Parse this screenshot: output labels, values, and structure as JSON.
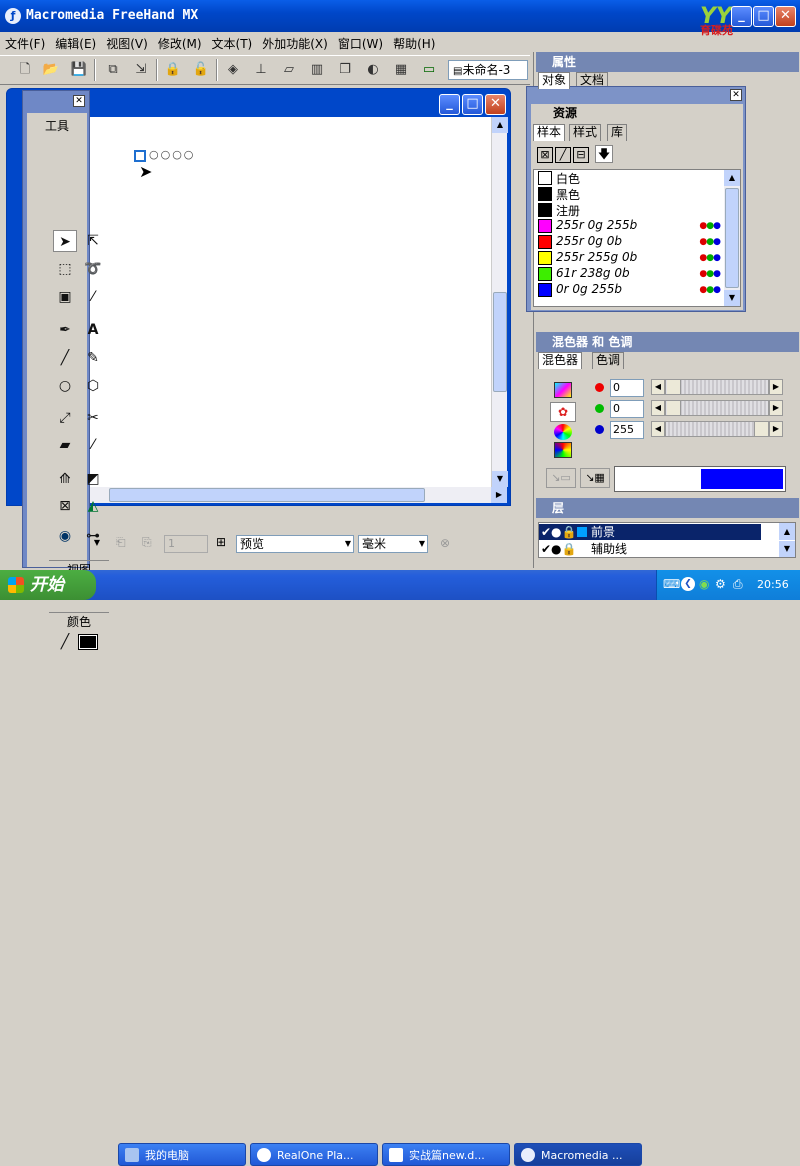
{
  "app": {
    "title": "Macromedia FreeHand MX",
    "logo_text": "育碟苑"
  },
  "menu": [
    "文件(F)",
    "编辑(E)",
    "视图(V)",
    "修改(M)",
    "文本(T)",
    "外加功能(X)",
    "窗口(W)",
    "帮助(H)"
  ],
  "toolbar": {
    "doc_select": "未命名-3"
  },
  "tools_panel": {
    "title": "工具",
    "view_label": "视图",
    "color_label": "颜色"
  },
  "status_bar": {
    "page_num": "1",
    "preview": "预览",
    "unit": "毫米"
  },
  "properties_panel": {
    "title": "属性",
    "tabs": [
      "对象",
      "文档"
    ]
  },
  "assets_panel": {
    "title": "资源",
    "tabs": [
      "样本",
      "样式",
      "库"
    ],
    "swatches": [
      {
        "name": "白色",
        "color": "#ffffff",
        "italic": false,
        "dots": false
      },
      {
        "name": "黑色",
        "color": "#000000",
        "italic": false,
        "dots": false
      },
      {
        "name": "注册",
        "color": "#000000",
        "italic": false,
        "dots": false
      },
      {
        "name": "255r 0g 255b",
        "color": "#ff00ff",
        "italic": true,
        "dots": true
      },
      {
        "name": "255r 0g 0b",
        "color": "#ff0000",
        "italic": true,
        "dots": true
      },
      {
        "name": "255r 255g 0b",
        "color": "#ffff00",
        "italic": true,
        "dots": true
      },
      {
        "name": "61r 238g 0b",
        "color": "#3dee00",
        "italic": true,
        "dots": true
      },
      {
        "name": "0r 0g 255b",
        "color": "#0000ff",
        "italic": true,
        "dots": true
      }
    ]
  },
  "mixer_panel": {
    "title": "混色器 和 色调",
    "tabs": [
      "混色器",
      "色调"
    ],
    "r": "0",
    "g": "0",
    "b": "255",
    "preview_color": "#0000ff"
  },
  "layers_panel": {
    "title": "层",
    "layers": [
      "前景",
      "辅助线"
    ]
  },
  "taskbar": {
    "start": "开始",
    "items": [
      "我的电脑",
      "RealOne Pla...",
      "实战篇new.d...",
      "Macromedia ..."
    ],
    "clock": "20:56"
  }
}
